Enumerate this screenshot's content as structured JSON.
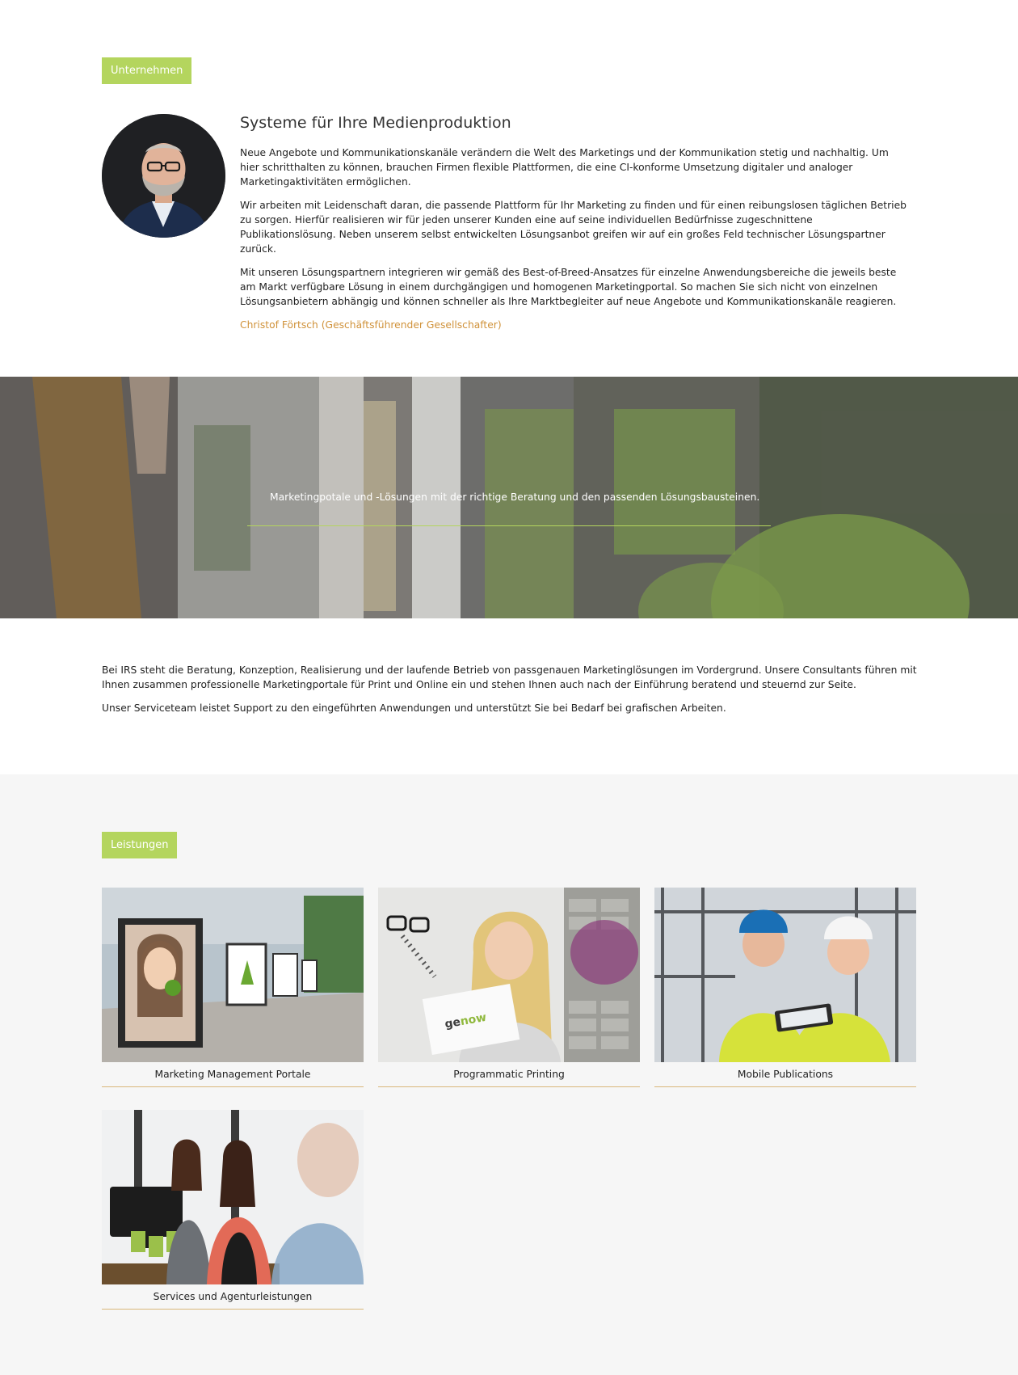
{
  "about": {
    "tag": "Unternehmen",
    "title": "Systeme für Ihre Medienproduktion",
    "paragraphs": [
      "Neue Angebote und Kommunikationskanäle verändern die Welt des Marketings und der Kommunikation stetig und nachhaltig. Um hier schritthalten zu können, brauchen Firmen flexible Plattformen, die eine CI-konforme Umsetzung digitaler und analoger Marketingaktivitäten ermöglichen.",
      "Wir arbeiten mit Leidenschaft daran, die passende Plattform für Ihr Marketing zu finden und für einen reibungslosen täglichen Betrieb zu sorgen. Hierfür realisieren wir für jeden unserer Kunden eine auf seine individuellen Bedürfnisse zugeschnittene Publikationslösung. Neben unserem selbst entwickelten Lösungsanbot greifen wir auf ein großes Feld technischer Lösungspartner zurück.",
      "Mit unseren Lösungspartnern integrieren wir gemäß des Best-of-Breed-Ansatzes für einzelne Anwendungsbereiche die jeweils beste am Markt verfügbare Lösung in einem durchgängigen und homogenen Marketingportal. So machen Sie sich nicht von einzelnen Lösungsanbietern abhängig und können schneller als Ihre Marktbegleiter auf neue Angebote und Kommunikationskanäle reagieren."
    ],
    "signature": "Christof Förtsch (Geschäftsführender Gesellschafter)"
  },
  "hero": {
    "text": "Marketingpotale und -Lösungen mit der richtige Beratung und den passenden Lösungsbausteinen."
  },
  "intro": {
    "paragraphs": [
      "Bei IRS steht die Beratung, Konzeption, Realisierung und der laufende Betrieb von passgenauen Marketinglösungen im Vordergrund. Unsere Consultants führen mit Ihnen zusammen professionelle Marketingportale für Print und Online ein und stehen Ihnen auch nach der Einführung beratend und steuernd zur Seite.",
      "Unser Serviceteam leistet Support zu den eingeführten Anwendungen und unterstützt Sie bei Bedarf bei grafischen Arbeiten."
    ]
  },
  "services": {
    "tag": "Leistungen",
    "items": [
      {
        "label": "Marketing Management Portale"
      },
      {
        "label": "Programmatic Printing"
      },
      {
        "label": "Mobile Publications"
      },
      {
        "label": "Services und Agenturleistungen"
      }
    ],
    "image_logo_text": "genow"
  },
  "colors": {
    "accent_green": "#b4d55e",
    "signature_orange": "#d0923a",
    "card_underline": "#d9b77a",
    "services_bg": "#f6f6f6"
  }
}
